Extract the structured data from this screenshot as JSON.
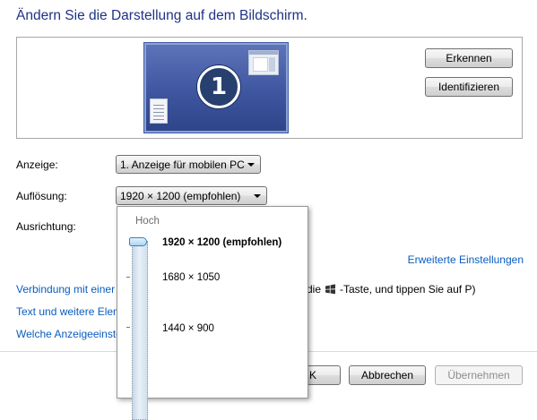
{
  "title": "Ändern Sie die Darstellung auf dem Bildschirm.",
  "monitor": {
    "number": "1"
  },
  "buttons": {
    "detect": "Erkennen",
    "identify": "Identifizieren",
    "ok": "OK",
    "ok_visible": "K",
    "cancel": "Abbrechen",
    "apply": "Übernehmen"
  },
  "fields": {
    "display_label": "Anzeige:",
    "display_value": "1. Anzeige für mobilen PC",
    "resolution_label": "Auflösung:",
    "resolution_value": "1920 × 1200 (empfohlen)",
    "orientation_label": "Ausrichtung:"
  },
  "links": {
    "advanced": "Erweiterte Einstellungen",
    "projector_visible": "Verbindung mit einer",
    "projector_tail_prefix": "die",
    "projector_tail_suffix": "-Taste, und tippen Sie auf P)",
    "text_size_visible": "Text und weitere Elen",
    "which_settings_visible": "Welche Anzeigeeinste"
  },
  "resolution_popup": {
    "top_label": "Hoch",
    "options": [
      "1920 × 1200 (empfohlen)",
      "1680 × 1050",
      "1440 × 900"
    ],
    "selected_index": 0
  },
  "icons": {
    "monitor": "display-monitor-icon",
    "windows_key": "windows-logo-icon"
  }
}
